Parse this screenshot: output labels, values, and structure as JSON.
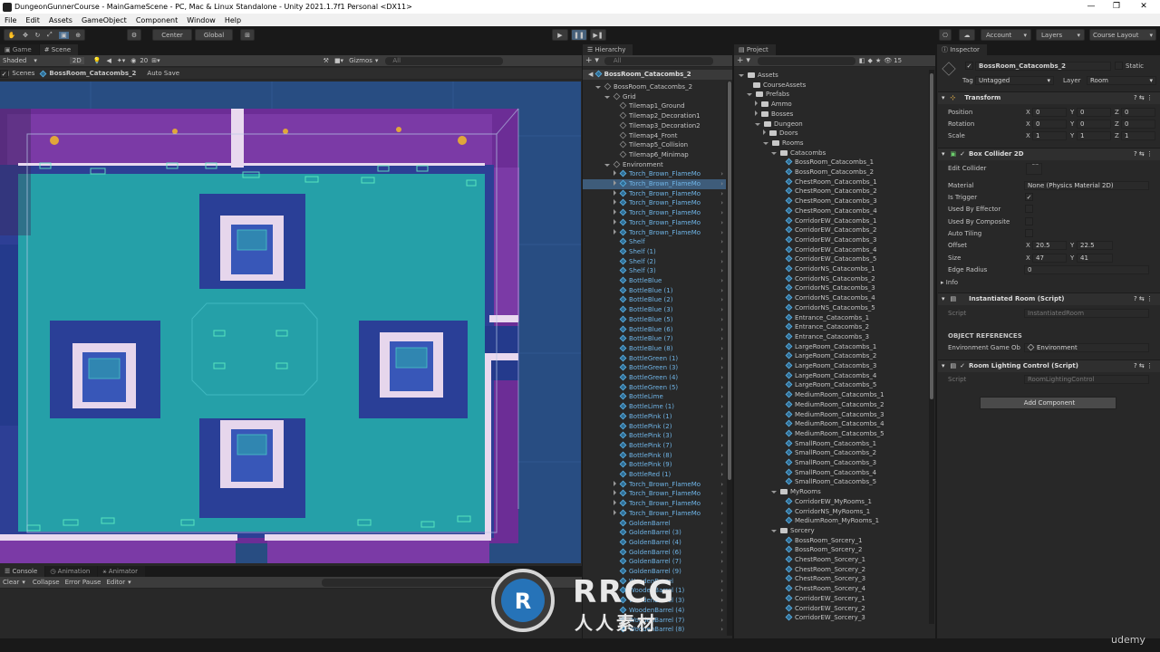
{
  "window": {
    "title": "DungeonGunnerCourse - MainGameScene - PC, Mac & Linux Standalone - Unity 2021.1.7f1 Personal <DX11>",
    "min": "—",
    "max": "❐",
    "close": "✕"
  },
  "menu": [
    "File",
    "Edit",
    "Assets",
    "GameObject",
    "Component",
    "Window",
    "Help"
  ],
  "toolbar": {
    "center": "Center",
    "global": "Global",
    "account": "Account",
    "layers": "Layers",
    "layout": "Course Layout",
    "play": "▶",
    "pause": "❚❚",
    "step": "▶❚"
  },
  "scene": {
    "tabs": [
      "Game",
      "Scene"
    ],
    "shading": "Shaded",
    "mode2d": "2D",
    "gizmos": "Gizmos",
    "search_placeholder": "All",
    "layer_count": "20",
    "breadcrumb_root": "Scenes",
    "breadcrumb_prefab": "BossRoom_Catacombs_2",
    "autosave": "Auto Save"
  },
  "console": {
    "tabs": [
      "Console",
      "Animation",
      "Animator"
    ],
    "buttons": [
      "Clear",
      "Collapse",
      "Error Pause",
      "Editor"
    ]
  },
  "hierarchy": {
    "tab": "Hierarchy",
    "search": "All",
    "root": "BossRoom_Catacombs_2",
    "rows": [
      {
        "t": "BossRoom_Catacombs_2",
        "i": 0,
        "arr": "d",
        "b": false
      },
      {
        "t": "Grid",
        "i": 1,
        "arr": "d",
        "b": false
      },
      {
        "t": "Tilemap1_Ground",
        "i": 2,
        "arr": "",
        "b": false
      },
      {
        "t": "Tilemap2_Decoration1",
        "i": 2,
        "arr": "",
        "b": false
      },
      {
        "t": "Tilemap3_Decoration2",
        "i": 2,
        "arr": "",
        "b": false
      },
      {
        "t": "Tilemap4_Front",
        "i": 2,
        "arr": "",
        "b": false
      },
      {
        "t": "Tilemap5_Collision",
        "i": 2,
        "arr": "",
        "b": false
      },
      {
        "t": "Tilemap6_Minimap",
        "i": 2,
        "arr": "",
        "b": false
      },
      {
        "t": "Environment",
        "i": 1,
        "arr": "d",
        "b": false
      },
      {
        "t": "Torch_Brown_FlameMo",
        "i": 2,
        "arr": "r",
        "b": true
      },
      {
        "t": "Torch_Brown_FlameMo",
        "i": 2,
        "arr": "r",
        "b": true
      },
      {
        "t": "Torch_Brown_FlameMo",
        "i": 2,
        "arr": "r",
        "b": true
      },
      {
        "t": "Torch_Brown_FlameMo",
        "i": 2,
        "arr": "r",
        "b": true
      },
      {
        "t": "Torch_Brown_FlameMo",
        "i": 2,
        "arr": "r",
        "b": true
      },
      {
        "t": "Torch_Brown_FlameMo",
        "i": 2,
        "arr": "r",
        "b": true
      },
      {
        "t": "Torch_Brown_FlameMo",
        "i": 2,
        "arr": "r",
        "b": true
      },
      {
        "t": "Shelf",
        "i": 2,
        "arr": "",
        "b": true
      },
      {
        "t": "Shelf (1)",
        "i": 2,
        "arr": "",
        "b": true
      },
      {
        "t": "Shelf (2)",
        "i": 2,
        "arr": "",
        "b": true
      },
      {
        "t": "Shelf (3)",
        "i": 2,
        "arr": "",
        "b": true
      },
      {
        "t": "BottleBlue",
        "i": 2,
        "arr": "",
        "b": true
      },
      {
        "t": "BottleBlue (1)",
        "i": 2,
        "arr": "",
        "b": true
      },
      {
        "t": "BottleBlue (2)",
        "i": 2,
        "arr": "",
        "b": true
      },
      {
        "t": "BottleBlue (3)",
        "i": 2,
        "arr": "",
        "b": true
      },
      {
        "t": "BottleBlue (5)",
        "i": 2,
        "arr": "",
        "b": true
      },
      {
        "t": "BottleBlue (6)",
        "i": 2,
        "arr": "",
        "b": true
      },
      {
        "t": "BottleBlue (7)",
        "i": 2,
        "arr": "",
        "b": true
      },
      {
        "t": "BottleBlue (8)",
        "i": 2,
        "arr": "",
        "b": true
      },
      {
        "t": "BottleGreen (1)",
        "i": 2,
        "arr": "",
        "b": true
      },
      {
        "t": "BottleGreen (3)",
        "i": 2,
        "arr": "",
        "b": true
      },
      {
        "t": "BottleGreen (4)",
        "i": 2,
        "arr": "",
        "b": true
      },
      {
        "t": "BottleGreen (5)",
        "i": 2,
        "arr": "",
        "b": true
      },
      {
        "t": "BottleLime",
        "i": 2,
        "arr": "",
        "b": true
      },
      {
        "t": "BottleLime (1)",
        "i": 2,
        "arr": "",
        "b": true
      },
      {
        "t": "BottlePink (1)",
        "i": 2,
        "arr": "",
        "b": true
      },
      {
        "t": "BottlePink (2)",
        "i": 2,
        "arr": "",
        "b": true
      },
      {
        "t": "BottlePink (3)",
        "i": 2,
        "arr": "",
        "b": true
      },
      {
        "t": "BottlePink (7)",
        "i": 2,
        "arr": "",
        "b": true
      },
      {
        "t": "BottlePink (8)",
        "i": 2,
        "arr": "",
        "b": true
      },
      {
        "t": "BottlePink (9)",
        "i": 2,
        "arr": "",
        "b": true
      },
      {
        "t": "BottleRed (1)",
        "i": 2,
        "arr": "",
        "b": true
      },
      {
        "t": "Torch_Brown_FlameMo",
        "i": 2,
        "arr": "r",
        "b": true
      },
      {
        "t": "Torch_Brown_FlameMo",
        "i": 2,
        "arr": "r",
        "b": true
      },
      {
        "t": "Torch_Brown_FlameMo",
        "i": 2,
        "arr": "r",
        "b": true
      },
      {
        "t": "Torch_Brown_FlameMo",
        "i": 2,
        "arr": "r",
        "b": true
      },
      {
        "t": "GoldenBarrel",
        "i": 2,
        "arr": "",
        "b": true
      },
      {
        "t": "GoldenBarrel (3)",
        "i": 2,
        "arr": "",
        "b": true
      },
      {
        "t": "GoldenBarrel (4)",
        "i": 2,
        "arr": "",
        "b": true
      },
      {
        "t": "GoldenBarrel (6)",
        "i": 2,
        "arr": "",
        "b": true
      },
      {
        "t": "GoldenBarrel (7)",
        "i": 2,
        "arr": "",
        "b": true
      },
      {
        "t": "GoldenBarrel (9)",
        "i": 2,
        "arr": "",
        "b": true
      },
      {
        "t": "WoodenBarrel",
        "i": 2,
        "arr": "",
        "b": true
      },
      {
        "t": "WoodenBarrel (1)",
        "i": 2,
        "arr": "",
        "b": true
      },
      {
        "t": "WoodenBarrel (3)",
        "i": 2,
        "arr": "",
        "b": true
      },
      {
        "t": "WoodenBarrel (4)",
        "i": 2,
        "arr": "",
        "b": true
      },
      {
        "t": "WoodenBarrel (7)",
        "i": 2,
        "arr": "",
        "b": true
      },
      {
        "t": "WoodenBarrel (8)",
        "i": 2,
        "arr": "",
        "b": true
      }
    ]
  },
  "project": {
    "tab": "Project",
    "count": "15",
    "rows": [
      {
        "t": "Assets",
        "i": 0,
        "k": "f",
        "a": "d"
      },
      {
        "t": "CourseAssets",
        "i": 1,
        "k": "f",
        "a": ""
      },
      {
        "t": "Prefabs",
        "i": 1,
        "k": "f",
        "a": "d"
      },
      {
        "t": "Ammo",
        "i": 2,
        "k": "f",
        "a": "r"
      },
      {
        "t": "Bosses",
        "i": 2,
        "k": "f",
        "a": "r"
      },
      {
        "t": "Dungeon",
        "i": 2,
        "k": "f",
        "a": "d"
      },
      {
        "t": "Doors",
        "i": 3,
        "k": "f",
        "a": "r"
      },
      {
        "t": "Rooms",
        "i": 3,
        "k": "f",
        "a": "d"
      },
      {
        "t": "Catacombs",
        "i": 4,
        "k": "f",
        "a": "d"
      },
      {
        "t": "BossRoom_Catacombs_1",
        "i": 5,
        "k": "p",
        "a": ""
      },
      {
        "t": "BossRoom_Catacombs_2",
        "i": 5,
        "k": "p",
        "a": ""
      },
      {
        "t": "ChestRoom_Catacombs_1",
        "i": 5,
        "k": "p",
        "a": ""
      },
      {
        "t": "ChestRoom_Catacombs_2",
        "i": 5,
        "k": "p",
        "a": ""
      },
      {
        "t": "ChestRoom_Catacombs_3",
        "i": 5,
        "k": "p",
        "a": ""
      },
      {
        "t": "ChestRoom_Catacombs_4",
        "i": 5,
        "k": "p",
        "a": ""
      },
      {
        "t": "CorridorEW_Catacombs_1",
        "i": 5,
        "k": "p",
        "a": ""
      },
      {
        "t": "CorridorEW_Catacombs_2",
        "i": 5,
        "k": "p",
        "a": ""
      },
      {
        "t": "CorridorEW_Catacombs_3",
        "i": 5,
        "k": "p",
        "a": ""
      },
      {
        "t": "CorridorEW_Catacombs_4",
        "i": 5,
        "k": "p",
        "a": ""
      },
      {
        "t": "CorridorEW_Catacombs_5",
        "i": 5,
        "k": "p",
        "a": ""
      },
      {
        "t": "CorridorNS_Catacombs_1",
        "i": 5,
        "k": "p",
        "a": ""
      },
      {
        "t": "CorridorNS_Catacombs_2",
        "i": 5,
        "k": "p",
        "a": ""
      },
      {
        "t": "CorridorNS_Catacombs_3",
        "i": 5,
        "k": "p",
        "a": ""
      },
      {
        "t": "CorridorNS_Catacombs_4",
        "i": 5,
        "k": "p",
        "a": ""
      },
      {
        "t": "CorridorNS_Catacombs_5",
        "i": 5,
        "k": "p",
        "a": ""
      },
      {
        "t": "Entrance_Catacombs_1",
        "i": 5,
        "k": "p",
        "a": ""
      },
      {
        "t": "Entrance_Catacombs_2",
        "i": 5,
        "k": "p",
        "a": ""
      },
      {
        "t": "Entrance_Catacombs_3",
        "i": 5,
        "k": "p",
        "a": ""
      },
      {
        "t": "LargeRoom_Catacombs_1",
        "i": 5,
        "k": "p",
        "a": ""
      },
      {
        "t": "LargeRoom_Catacombs_2",
        "i": 5,
        "k": "p",
        "a": ""
      },
      {
        "t": "LargeRoom_Catacombs_3",
        "i": 5,
        "k": "p",
        "a": ""
      },
      {
        "t": "LargeRoom_Catacombs_4",
        "i": 5,
        "k": "p",
        "a": ""
      },
      {
        "t": "LargeRoom_Catacombs_5",
        "i": 5,
        "k": "p",
        "a": ""
      },
      {
        "t": "MediumRoom_Catacombs_1",
        "i": 5,
        "k": "p",
        "a": ""
      },
      {
        "t": "MediumRoom_Catacombs_2",
        "i": 5,
        "k": "p",
        "a": ""
      },
      {
        "t": "MediumRoom_Catacombs_3",
        "i": 5,
        "k": "p",
        "a": ""
      },
      {
        "t": "MediumRoom_Catacombs_4",
        "i": 5,
        "k": "p",
        "a": ""
      },
      {
        "t": "MediumRoom_Catacombs_5",
        "i": 5,
        "k": "p",
        "a": ""
      },
      {
        "t": "SmallRoom_Catacombs_1",
        "i": 5,
        "k": "p",
        "a": ""
      },
      {
        "t": "SmallRoom_Catacombs_2",
        "i": 5,
        "k": "p",
        "a": ""
      },
      {
        "t": "SmallRoom_Catacombs_3",
        "i": 5,
        "k": "p",
        "a": ""
      },
      {
        "t": "SmallRoom_Catacombs_4",
        "i": 5,
        "k": "p",
        "a": ""
      },
      {
        "t": "SmallRoom_Catacombs_5",
        "i": 5,
        "k": "p",
        "a": ""
      },
      {
        "t": "MyRooms",
        "i": 4,
        "k": "f",
        "a": "d"
      },
      {
        "t": "CorridorEW_MyRooms_1",
        "i": 5,
        "k": "p",
        "a": ""
      },
      {
        "t": "CorridorNS_MyRooms_1",
        "i": 5,
        "k": "p",
        "a": ""
      },
      {
        "t": "MediumRoom_MyRooms_1",
        "i": 5,
        "k": "p",
        "a": ""
      },
      {
        "t": "Sorcery",
        "i": 4,
        "k": "f",
        "a": "d"
      },
      {
        "t": "BossRoom_Sorcery_1",
        "i": 5,
        "k": "p",
        "a": ""
      },
      {
        "t": "BossRoom_Sorcery_2",
        "i": 5,
        "k": "p",
        "a": ""
      },
      {
        "t": "ChestRoom_Sorcery_1",
        "i": 5,
        "k": "p",
        "a": ""
      },
      {
        "t": "ChestRoom_Sorcery_2",
        "i": 5,
        "k": "p",
        "a": ""
      },
      {
        "t": "ChestRoom_Sorcery_3",
        "i": 5,
        "k": "p",
        "a": ""
      },
      {
        "t": "ChestRoom_Sorcery_4",
        "i": 5,
        "k": "p",
        "a": ""
      },
      {
        "t": "CorridorEW_Sorcery_1",
        "i": 5,
        "k": "p",
        "a": ""
      },
      {
        "t": "CorridorEW_Sorcery_2",
        "i": 5,
        "k": "p",
        "a": ""
      },
      {
        "t": "CorridorEW_Sorcery_3",
        "i": 5,
        "k": "p",
        "a": ""
      }
    ]
  },
  "inspector": {
    "tab": "Inspector",
    "name": "BossRoom_Catacombs_2",
    "static": "Static",
    "tag_label": "Tag",
    "tag": "Untagged",
    "layer_label": "Layer",
    "layer": "Room",
    "transform": {
      "title": "Transform",
      "position": "Position",
      "rotation": "Rotation",
      "scale": "Scale",
      "px": "0",
      "py": "0",
      "pz": "0",
      "rx": "0",
      "ry": "0",
      "rz": "0",
      "sx": "1",
      "sy": "1",
      "sz": "1"
    },
    "collider": {
      "title": "Box Collider 2D",
      "edit": "Edit Collider",
      "material_label": "Material",
      "material": "None (Physics Material 2D)",
      "trigger": "Is Trigger",
      "effector": "Used By Effector",
      "composite": "Used By Composite",
      "tiling": "Auto Tiling",
      "offset": "Offset",
      "ox": "20.5",
      "oy": "22.5",
      "size": "Size",
      "szx": "47",
      "szy": "41",
      "radius": "Edge Radius",
      "r": "0",
      "info": "Info"
    },
    "room_script": {
      "title": "Instantiated Room (Script)",
      "script_label": "Script",
      "script": "InstantiatedRoom",
      "refs": "OBJECT REFERENCES",
      "env_label": "Environment Game Ob",
      "env": "Environment"
    },
    "lighting": {
      "title": "Room Lighting Control (Script)",
      "script_label": "Script",
      "script": "RoomLightingControl"
    },
    "add_component": "Add Component"
  },
  "watermark": {
    "big": "RRCG",
    "small": "人人素材",
    "udemy": "udemy"
  },
  "colors": {
    "panel": "#282828",
    "dark": "#191919",
    "scene_bg": "#284878",
    "wall": "#6b2a8f",
    "floor": "#1f8fa0",
    "prefab_blue": "#6fb4e6"
  }
}
